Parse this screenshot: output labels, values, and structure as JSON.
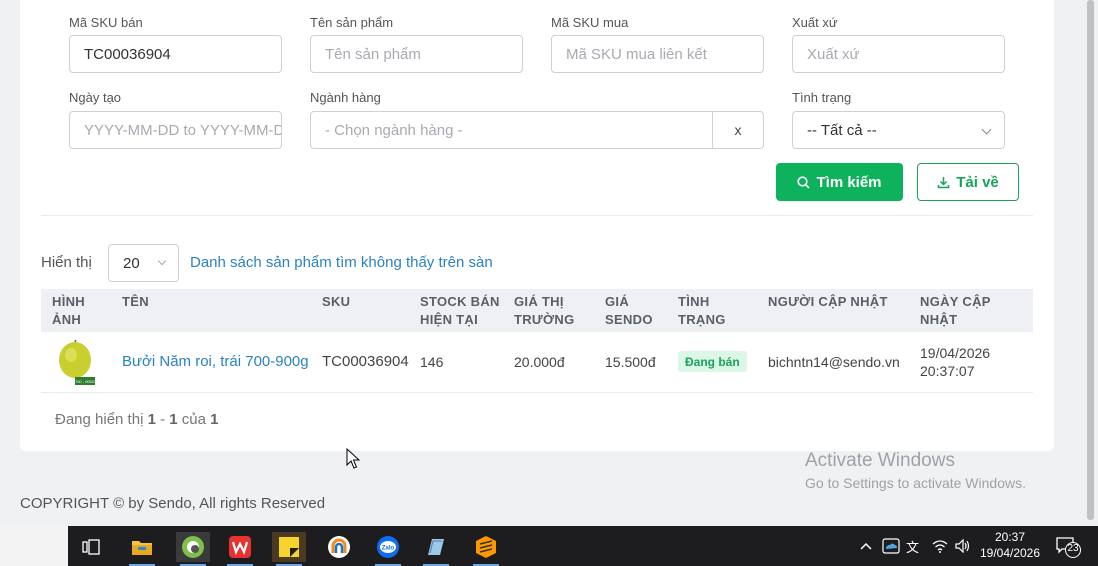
{
  "filters": {
    "sku_ban": {
      "label": "Mã SKU bán",
      "value": "TC00036904"
    },
    "ten_sp": {
      "label": "Tên sản phẩm",
      "placeholder": "Tên sản phẩm"
    },
    "sku_mua": {
      "label": "Mã SKU mua",
      "placeholder": "Mã SKU mua liên kết"
    },
    "xuat_xu": {
      "label": "Xuất xứ",
      "placeholder": "Xuất xứ"
    },
    "ngay_tao": {
      "label": "Ngày tạo",
      "placeholder": "YYYY-MM-DD to YYYY-MM-DD"
    },
    "nganh_hang": {
      "label": "Ngành hàng",
      "placeholder": "- Chọn ngành hàng -",
      "clear": "x"
    },
    "tinh_trang": {
      "label": "Tình trạng",
      "value": "-- Tất cả --"
    }
  },
  "actions": {
    "search": "Tìm kiếm",
    "download": "Tải về"
  },
  "list_controls": {
    "show_label": "Hiển thị",
    "page_size": "20",
    "not_found_link": "Danh sách sản phẩm tìm không thấy trên sàn"
  },
  "table": {
    "headers": {
      "image": [
        "HÌNH",
        "ẢNH"
      ],
      "name": [
        "TÊN"
      ],
      "sku": [
        "SKU"
      ],
      "stock": [
        "STOCK BÁN",
        "HIỆN TẠI"
      ],
      "market_price": [
        "GIÁ THỊ",
        "TRƯỜNG"
      ],
      "sendo_price": [
        "GIÁ",
        "SENDO"
      ],
      "status": [
        "TÌNH",
        "TRẠNG"
      ],
      "updater": [
        "NGƯỜI CẬP NHẬT"
      ],
      "updated": [
        "NGÀY CẬP",
        "NHẬT"
      ]
    },
    "rows": [
      {
        "name": "Bưởi Năm roi, trái 700-900g",
        "image_label": "700 - 900G",
        "sku": "TC00036904",
        "stock": "146",
        "market_price": "20.000đ",
        "sendo_price": "15.500đ",
        "status": "Đang bán",
        "updater": "bichntn14@sendo.vn",
        "updated_date": "19/04/2026",
        "updated_time": "20:37:07"
      }
    ]
  },
  "pagination": {
    "prefix": "Đang hiển thị",
    "from": "1",
    "to": "1",
    "of_label": "của",
    "total": "1"
  },
  "copyright": "COPYRIGHT © by Sendo, All rights Reserved",
  "watermark": {
    "title": "Activate Windows",
    "subtitle": "Go to Settings to activate Windows."
  },
  "taskbar": {
    "time": "20:37",
    "date": "19/04/2026",
    "notifications": "23",
    "lang": "文"
  },
  "colors": {
    "primary_green": "#0eb25d",
    "link_blue": "#2a83c0",
    "badge_bg": "#dcf6e7"
  }
}
